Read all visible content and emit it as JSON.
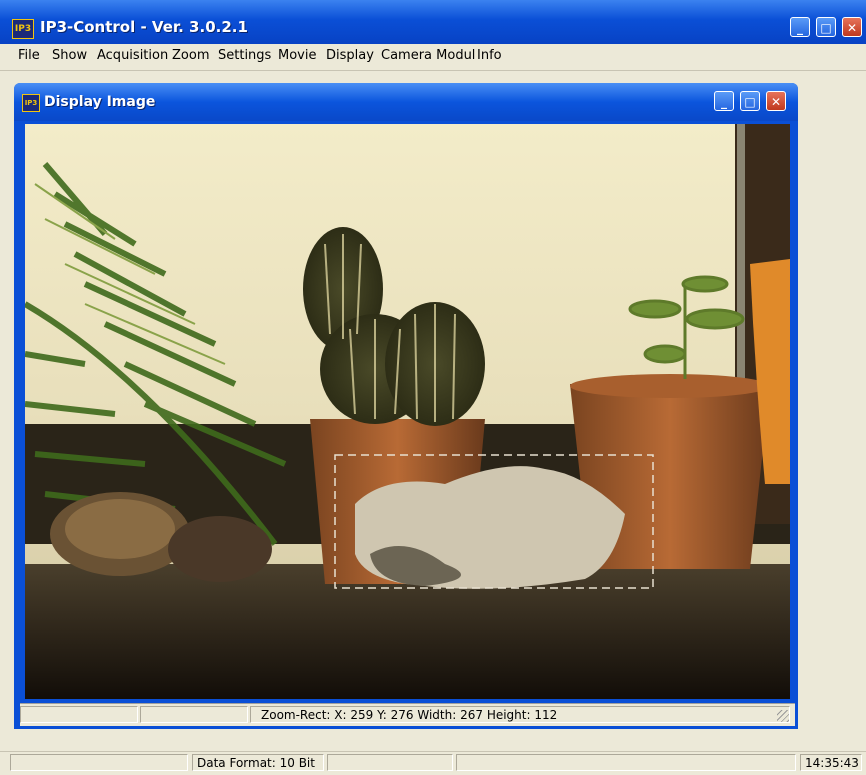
{
  "app": {
    "title": "IP3-Control - Ver. 3.0.2.1",
    "icon": "ip-icon",
    "icon_text": "IP3"
  },
  "window_buttons": {
    "minimize": "minimize-icon",
    "maximize": "maximize-icon",
    "close": "close-icon"
  },
  "menu": {
    "items": [
      {
        "label": "File"
      },
      {
        "label": "Show"
      },
      {
        "label": "Acquisition"
      },
      {
        "label": "Zoom"
      },
      {
        "label": "Settings"
      },
      {
        "label": "Movie"
      },
      {
        "label": "Display"
      },
      {
        "label": "Camera Modul"
      },
      {
        "label": "Info"
      }
    ]
  },
  "display_window": {
    "title": "Display Image",
    "status": {
      "zoom_rect": "Zoom-Rect:  X: 259  Y: 276  Width: 267  Height: 112"
    }
  },
  "statusbar": {
    "data_format": "Data Format: 10 Bit",
    "time": "14:35:43"
  },
  "colors": {
    "title_blue": "#0a4fd6",
    "panel": "#ece9d8",
    "close_red": "#c0391f"
  }
}
